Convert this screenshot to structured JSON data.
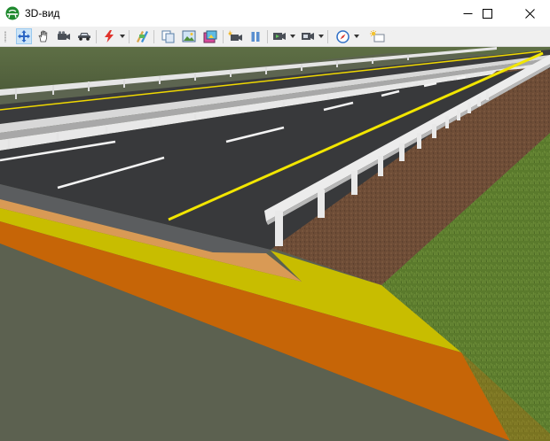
{
  "window": {
    "title": "3D-вид",
    "icon": "road-app-icon",
    "controls": [
      "minimize-icon",
      "maximize-icon",
      "close-icon"
    ]
  },
  "toolbar": {
    "items": [
      {
        "name": "pan-move-tool",
        "icon": "move-arrows-icon",
        "active": true
      },
      {
        "name": "hand-tool",
        "icon": "hand-icon"
      },
      {
        "name": "camera-tool",
        "icon": "video-camera-icon"
      },
      {
        "name": "car-drive-tool",
        "icon": "car-icon"
      },
      {
        "name": "lightning-tool",
        "icon": "lightning-icon",
        "dropdown": true
      },
      {
        "name": "texture-tool",
        "icon": "texture-icon"
      },
      {
        "name": "copy-view-tool",
        "icon": "copy-icon"
      },
      {
        "name": "image-export-tool",
        "icon": "image-icon"
      },
      {
        "name": "render-tool",
        "icon": "render-icon"
      },
      {
        "name": "record-tool",
        "icon": "record-camera-icon"
      },
      {
        "name": "pause-tool",
        "icon": "pause-icon"
      },
      {
        "name": "playback-tool",
        "icon": "playback-icon",
        "dropdown": true
      },
      {
        "name": "save-view-tool",
        "icon": "save-view-icon",
        "dropdown": true
      },
      {
        "name": "compass-tool",
        "icon": "compass-icon",
        "dropdown": true
      },
      {
        "name": "sun-light-tool",
        "icon": "sun-icon"
      }
    ]
  },
  "scene": {
    "description_colors": {
      "sky_grass": "#556a3e",
      "asphalt": "#3a3b3d",
      "median_line": "#f2e600",
      "lane_marking": "#f4f4f4",
      "soil": "#6b4a34",
      "grass": "#5d7a2e",
      "subgrade_orange": "#c76606",
      "subgrade_yellow": "#c8c000",
      "ground": "#5f6450"
    }
  }
}
